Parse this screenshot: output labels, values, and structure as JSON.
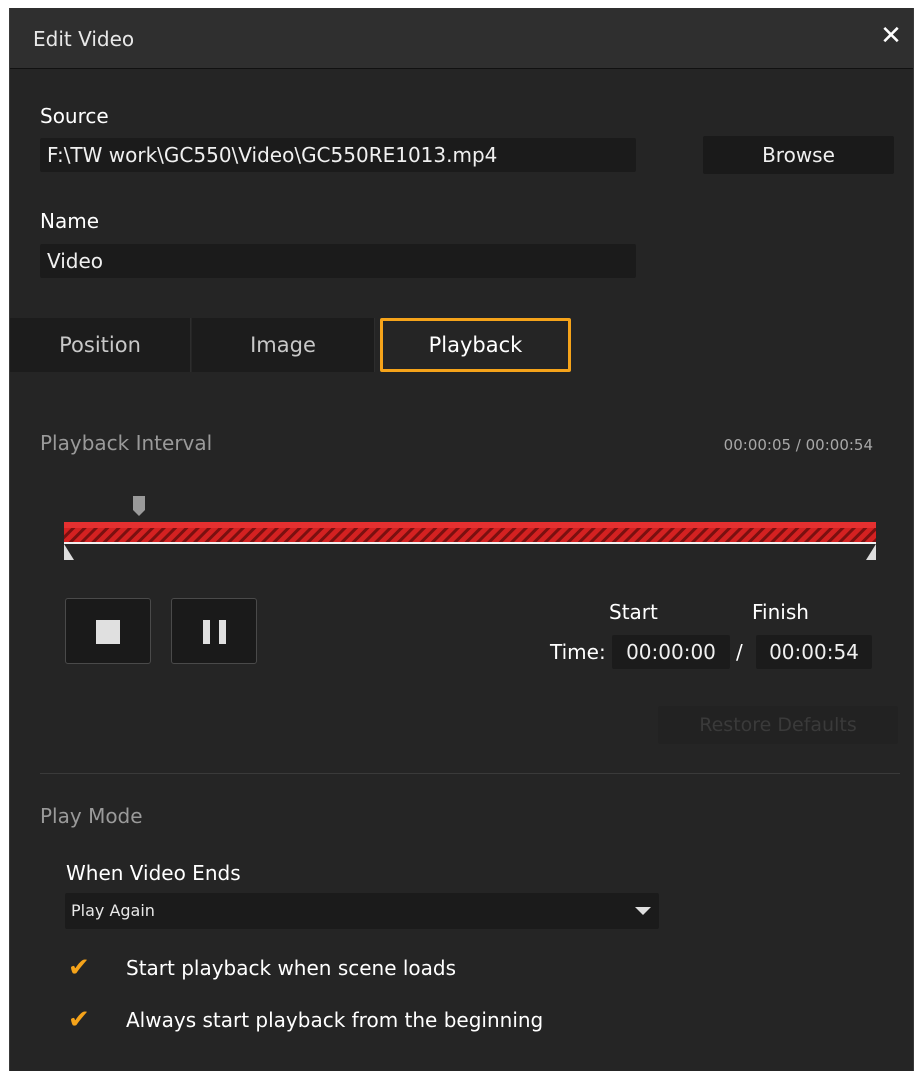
{
  "window": {
    "title": "Edit Video",
    "close_icon": "close-icon"
  },
  "source": {
    "label": "Source",
    "value": "F:\\TW work\\GC550\\Video\\GC550RE1013.mp4",
    "browse_label": "Browse"
  },
  "name": {
    "label": "Name",
    "value": "Video"
  },
  "tabs": [
    {
      "label": "Position",
      "active": false
    },
    {
      "label": "Image",
      "active": false
    },
    {
      "label": "Playback",
      "active": true
    }
  ],
  "playback": {
    "interval_label": "Playback Interval",
    "time_readout": "00:00:05 / 00:00:54",
    "progress": 0.0926,
    "track_color": "#d42121",
    "start_label": "Start",
    "finish_label": "Finish",
    "time_label": "Time:",
    "start_time": "00:00:00",
    "separator": "/",
    "finish_time": "00:00:54",
    "restore_label": "Restore Defaults"
  },
  "play_mode": {
    "section_label": "Play Mode",
    "when_ends_label": "When Video Ends",
    "when_ends_value": "Play Again",
    "options": [
      {
        "label": "Start playback when scene loads",
        "checked": true
      },
      {
        "label": "Always start playback from the beginning",
        "checked": true
      }
    ]
  },
  "colors": {
    "accent": "#f5a31a",
    "background": "#252525",
    "field": "#1b1b1b"
  }
}
